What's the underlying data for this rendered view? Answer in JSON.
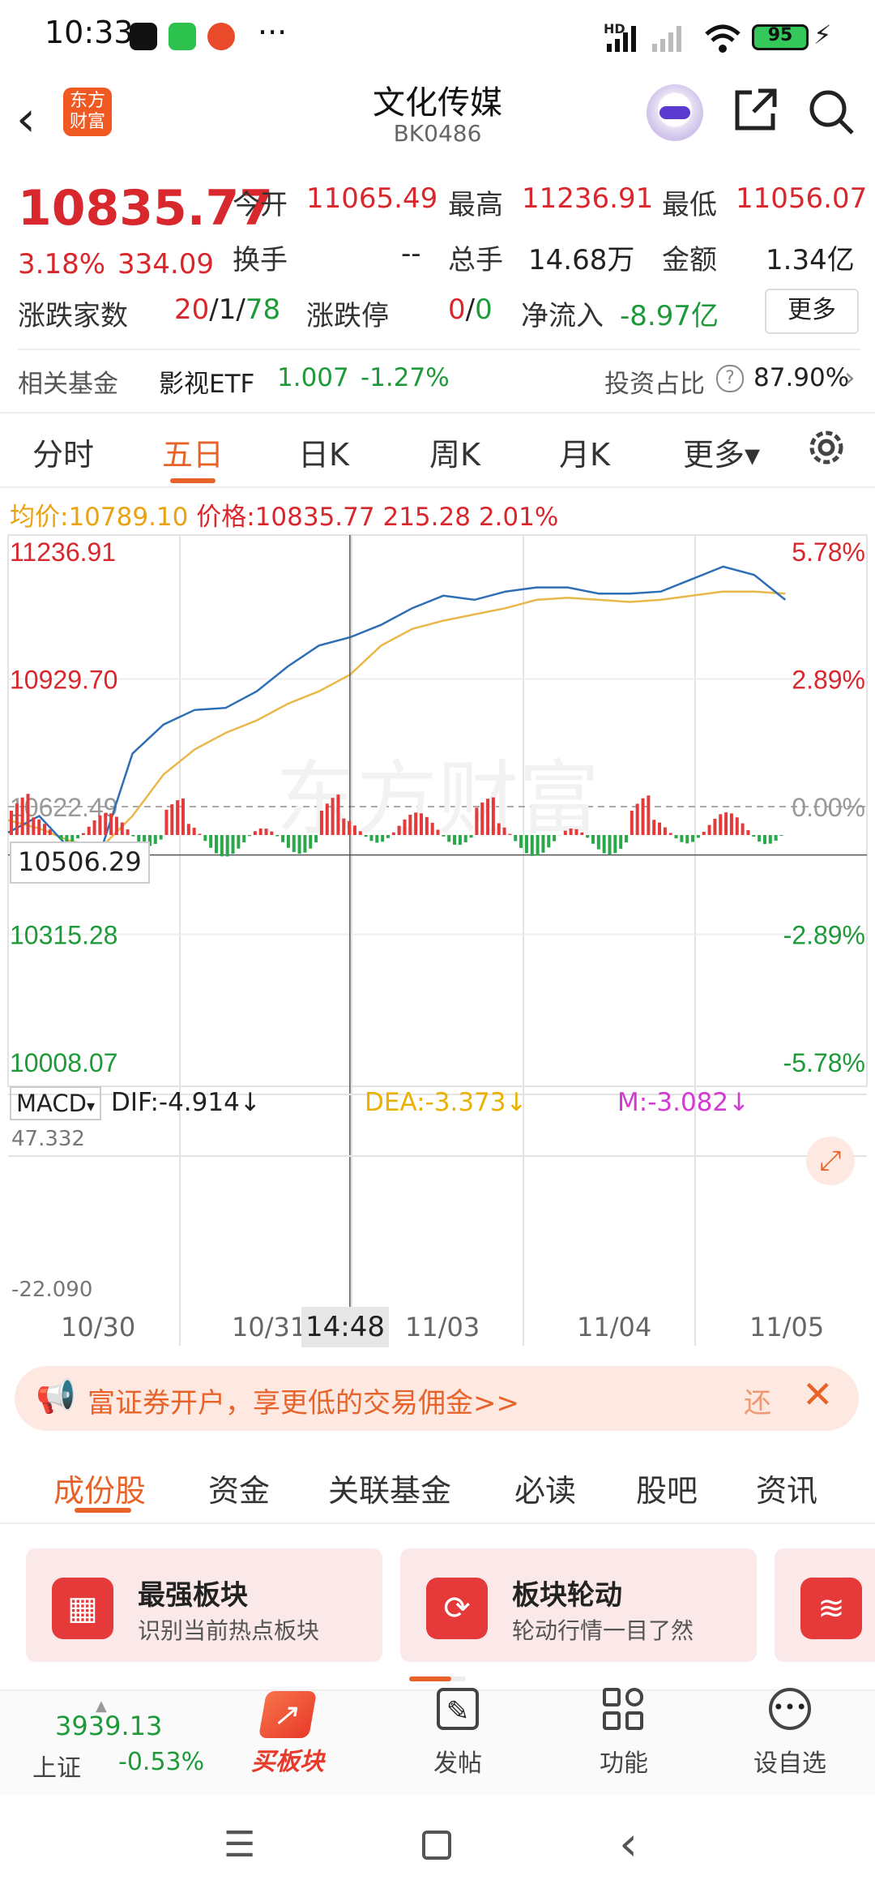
{
  "status_bar": {
    "time": "10:33",
    "dots": "···",
    "battery": "95",
    "hd_label": "HD"
  },
  "header": {
    "logo_text_top": "东方",
    "logo_text_bottom": "财富",
    "title": "文化传媒",
    "code": "BK0486"
  },
  "quote": {
    "price": "10835.77",
    "change_pct": "3.18%",
    "change_val": "334.09",
    "open_label": "今开",
    "open": "11065.49",
    "high_label": "最高",
    "high": "11236.91",
    "low_label": "最低",
    "low": "11056.07",
    "turnover_label": "换手",
    "turnover": "--",
    "volume_label": "总手",
    "volume": "14.68万",
    "amount_label": "金额",
    "amount": "1.34亿",
    "breadth_label": "涨跌家数",
    "breadth_up": "20",
    "breadth_sep1": "/",
    "breadth_flat": "1",
    "breadth_sep2": "/",
    "breadth_down": "78",
    "limit_label": "涨跌停",
    "limit_up": "0",
    "limit_sep": "/",
    "limit_down": "0",
    "netflow_label": "净流入",
    "netflow": "-8.97亿",
    "more_button": "更多"
  },
  "fund_row": {
    "label": "相关基金",
    "fund_name": "影视ETF",
    "fund_price": "1.007",
    "fund_change": "-1.27%",
    "ratio_label": "投资占比",
    "ratio_icon": "?",
    "ratio": "87.90%"
  },
  "chart_tabs": [
    {
      "label": "分时"
    },
    {
      "label": "五日"
    },
    {
      "label": "日K"
    },
    {
      "label": "周K"
    },
    {
      "label": "月K"
    },
    {
      "label": "更多▾"
    }
  ],
  "info_line": {
    "avg_label": "均价:",
    "avg": "10789.10",
    "price_label": "价格:",
    "price": "10835.77",
    "chg": "215.28",
    "pct": "2.01%"
  },
  "chart_data": {
    "type": "line",
    "title": "",
    "x": [
      "10/30",
      "10/31",
      "11/03",
      "11/04",
      "11/05"
    ],
    "ylim": [
      10008.07,
      11236.91
    ],
    "y_ticks_left": [
      "11236.91",
      "10929.70",
      "10622.49",
      "10315.28",
      "10008.07"
    ],
    "y_ticks_right": [
      "5.78%",
      "2.89%",
      "0.00%",
      "-2.89%",
      "-5.78%"
    ],
    "crosshair_price": "10506.29",
    "crosshair_time": "14:48",
    "series": [
      {
        "name": "价格",
        "values": [
          10560,
          10600,
          10520,
          10520,
          10750,
          10820,
          10855,
          10860,
          10900,
          10960,
          11010,
          11030,
          11060,
          11100,
          11130,
          11120,
          11140,
          11150,
          11150,
          11135,
          11135,
          11140,
          11170,
          11200,
          11180,
          11120
        ]
      },
      {
        "name": "均价",
        "values": [
          10590,
          10570,
          10540,
          10525,
          10600,
          10700,
          10760,
          10800,
          10830,
          10870,
          10900,
          10940,
          11010,
          11050,
          11070,
          11085,
          11100,
          11120,
          11125,
          11120,
          11115,
          11120,
          11130,
          11140,
          11140,
          11135
        ]
      }
    ],
    "macd": {
      "label": "MACD",
      "dif": "DIF:-4.914↓",
      "dea": "DEA:-3.373↓",
      "m": "M:-3.082↓",
      "top": "47.332",
      "bottom": "-22.090"
    },
    "colors": {
      "price": "#2e6eb5",
      "avg": "#e9b84a",
      "up": "#e33b3b",
      "down": "#2aa84a",
      "watermark": "东方财富"
    }
  },
  "promo": {
    "text": "富证券开户，享更低的交易佣金>>",
    "tail": "还",
    "close": "✕"
  },
  "section_tabs": [
    {
      "label": "成份股"
    },
    {
      "label": "资金"
    },
    {
      "label": "关联基金"
    },
    {
      "label": "必读"
    },
    {
      "label": "股吧"
    },
    {
      "label": "资讯"
    }
  ],
  "cards": [
    {
      "title": "最强板块",
      "subtitle": "识别当前热点板块"
    },
    {
      "title": "板块轮动",
      "subtitle": "轮动行情一目了然"
    }
  ],
  "bottom_nav": {
    "index_value": "3939.13",
    "index_name": "上证",
    "index_change": "-0.53%",
    "buy_label": "买板块",
    "post_label": "发帖",
    "func_label": "功能",
    "watch_label": "设自选"
  },
  "colors": {
    "accent": "#e8632a",
    "up": "#d9272e",
    "down": "#1f9a3a"
  }
}
